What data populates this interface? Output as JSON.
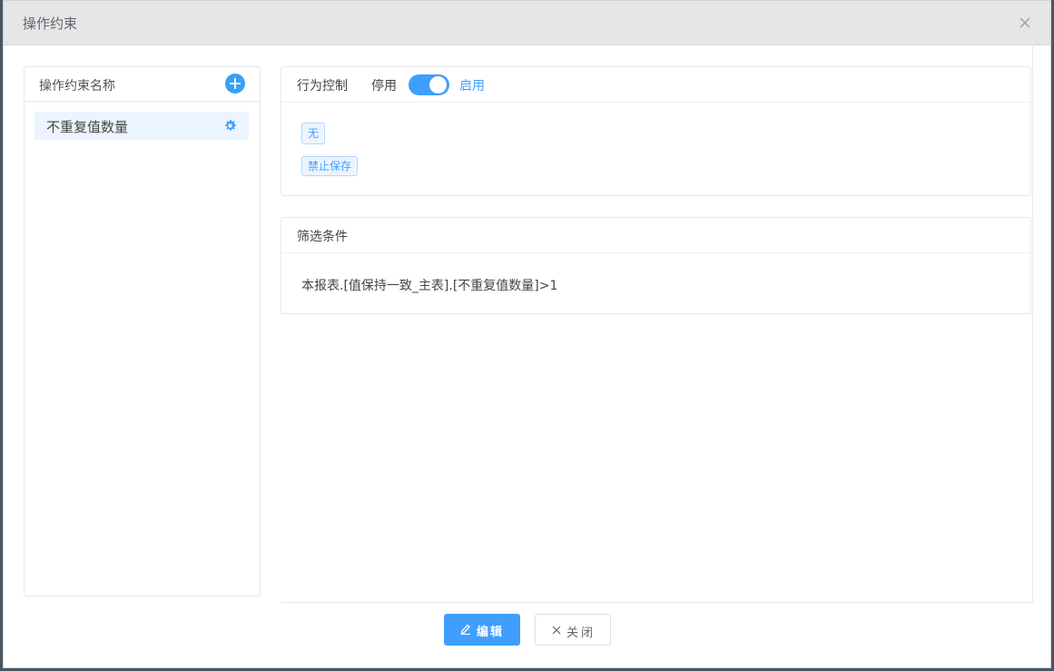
{
  "dialog": {
    "title": "操作约束"
  },
  "left_panel": {
    "title": "操作约束名称",
    "items": [
      {
        "label": "不重复值数量"
      }
    ]
  },
  "behavior_card": {
    "title": "行为控制",
    "switch_off_label": "停用",
    "switch_on_label": "启用",
    "switch_enabled": true,
    "tags": [
      "无",
      "禁止保存"
    ]
  },
  "filter_card": {
    "title": "筛选条件",
    "condition": "本报表.[值保持一致_主表].[不重复值数量]>1"
  },
  "footer": {
    "edit_label": "编辑",
    "close_label": "关闭"
  },
  "colors": {
    "accent": "#409eff",
    "header_bg": "#e6e6e6",
    "selected_bg": "#ecf5ff"
  },
  "icons": {
    "close": "close-icon",
    "add": "plus-circle-icon",
    "settings": "gear-icon",
    "edit": "pencil-icon",
    "close_button": "x-icon"
  }
}
